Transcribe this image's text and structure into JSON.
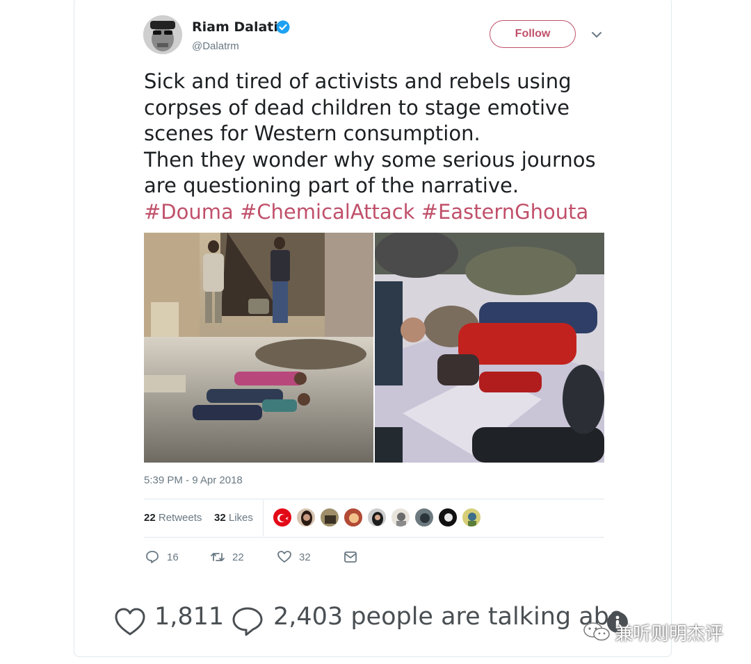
{
  "tweet": {
    "author_name": "Riam Dalati",
    "handle": "@Dalatrm",
    "follow_label": "Follow",
    "text_lines": [
      "Sick and tired of activists and rebels using",
      "corpses of dead children to stage emotive",
      "scenes for Western consumption.",
      "Then they wonder why some serious journos",
      "are questioning part of the narrative."
    ],
    "hashtags": [
      "#Douma",
      "#ChemicalAttack",
      "#EasternGhouta"
    ],
    "timestamp": "5:39 PM - 9 Apr 2018",
    "stats": {
      "retweets_count": "22",
      "retweets_label": "Retweets",
      "likes_count": "32",
      "likes_label": "Likes"
    },
    "actions": {
      "reply_count": "16",
      "retweet_count": "22",
      "like_count": "32"
    }
  },
  "footer": {
    "likes": "1,811",
    "talking": "2,403 people are talking abo"
  },
  "watermark": {
    "text": "兼听则明杰评"
  },
  "colors": {
    "accent": "#c0506a",
    "verified": "#1da1f2",
    "muted": "#697882"
  },
  "icons": {
    "verified": "verified-badge-icon",
    "caret": "chevron-down-icon",
    "reply": "reply-icon",
    "retweet": "retweet-icon",
    "like": "heart-icon",
    "dm": "message-icon",
    "footer_like": "heart-icon",
    "footer_comment": "comment-icon",
    "info": "info-icon"
  }
}
